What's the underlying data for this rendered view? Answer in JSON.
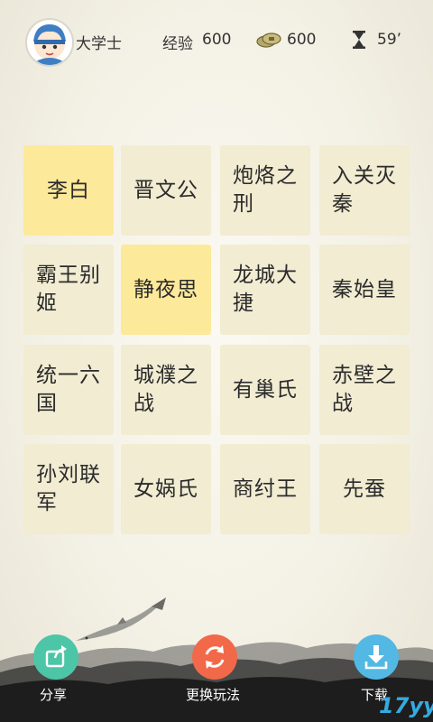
{
  "header": {
    "player_title": "大学士",
    "exp_label": "经验",
    "exp_value": "600",
    "coins_value": "600",
    "timer_value": "59’"
  },
  "grid": {
    "tiles": [
      {
        "text": "李白",
        "selected": true
      },
      {
        "text": "晋文公",
        "selected": false
      },
      {
        "text": "炮烙之刑",
        "selected": false
      },
      {
        "text": "入关灭秦",
        "selected": false
      },
      {
        "text": "霸王别姬",
        "selected": false
      },
      {
        "text": "静夜思",
        "selected": true
      },
      {
        "text": "龙城大捷",
        "selected": false
      },
      {
        "text": "秦始皇",
        "selected": false
      },
      {
        "text": "统一六国",
        "selected": false
      },
      {
        "text": "城濮之战",
        "selected": false
      },
      {
        "text": "有巢氏",
        "selected": false
      },
      {
        "text": "赤壁之战",
        "selected": false
      },
      {
        "text": "孙刘联军",
        "selected": false
      },
      {
        "text": "女娲氏",
        "selected": false
      },
      {
        "text": "商纣王",
        "selected": false
      },
      {
        "text": "先蚕",
        "selected": false
      }
    ]
  },
  "footer": {
    "share_label": "分享",
    "switch_label": "更换玩法",
    "download_label": "下载",
    "brand": "17yy"
  },
  "colors": {
    "tile": "#f1ecd2",
    "tile_selected": "#fde99a",
    "share": "#4cc6a6",
    "switch": "#f2694a",
    "download": "#53b8e3"
  },
  "icons": {
    "avatar": "scholar-avatar-icon",
    "coins": "coin-icon",
    "timer": "hourglass-icon",
    "share": "share-icon",
    "switch": "refresh-icon",
    "download": "download-icon"
  }
}
